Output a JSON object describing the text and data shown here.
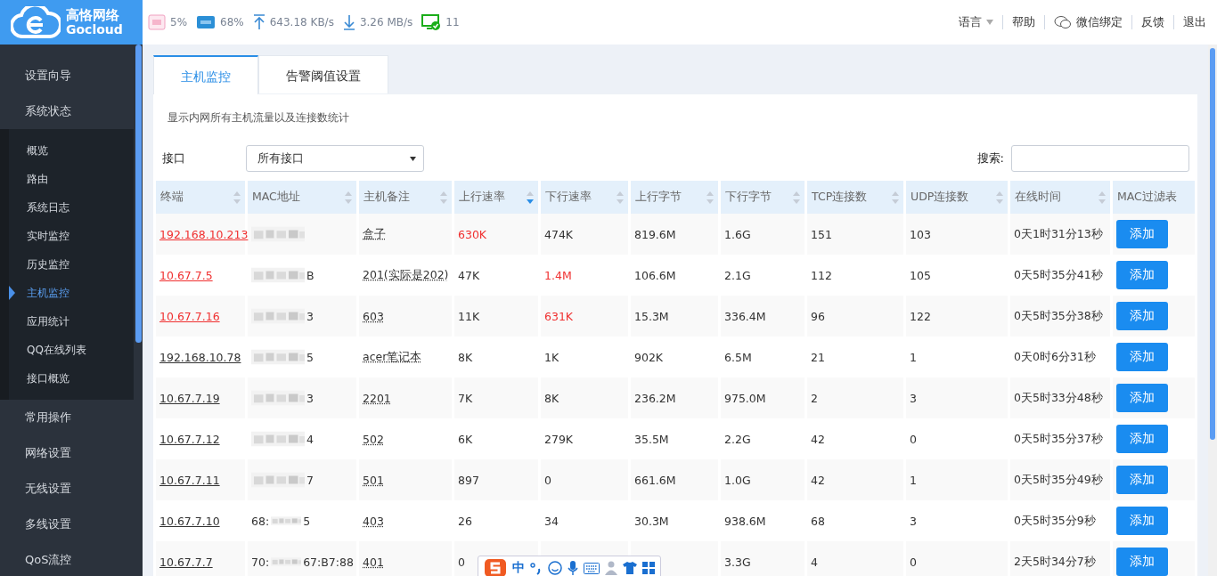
{
  "logo": {
    "name": "高恪网络",
    "brand": "Gocloud"
  },
  "status": [
    {
      "kind": "cpu",
      "value": "5%"
    },
    {
      "kind": "ram",
      "value": "68%"
    },
    {
      "kind": "up",
      "value": "643.18 KB/s"
    },
    {
      "kind": "down",
      "value": "3.26 MB/s"
    },
    {
      "kind": "online",
      "value": "11"
    }
  ],
  "top_links": [
    {
      "kind": "dropdown",
      "label": "语言"
    },
    {
      "kind": "plain",
      "label": "帮助"
    },
    {
      "kind": "wechat",
      "label": "微信绑定"
    },
    {
      "kind": "plain",
      "label": "反馈"
    },
    {
      "kind": "plain",
      "label": "退出"
    }
  ],
  "sidebar": {
    "items": [
      {
        "label": "设置向导"
      },
      {
        "label": "系统状态",
        "expanded": true,
        "children": [
          {
            "label": "概览",
            "selected": false
          },
          {
            "label": "路由",
            "selected": false
          },
          {
            "label": "系统日志",
            "selected": false
          },
          {
            "label": "实时监控",
            "selected": false
          },
          {
            "label": "历史监控",
            "selected": false
          },
          {
            "label": "主机监控",
            "selected": true
          },
          {
            "label": "应用统计",
            "selected": false
          },
          {
            "label": "QQ在线列表",
            "selected": false
          },
          {
            "label": "接口概览",
            "selected": false
          }
        ]
      },
      {
        "label": "常用操作"
      },
      {
        "label": "网络设置"
      },
      {
        "label": "无线设置"
      },
      {
        "label": "多线设置"
      },
      {
        "label": "QoS流控"
      }
    ]
  },
  "tabs": [
    {
      "label": "主机监控",
      "selected": true
    },
    {
      "label": "告警阈值设置",
      "selected": false
    }
  ],
  "description": "显示内网所有主机流量以及连接数统计",
  "interface": {
    "label": "接口",
    "value": "所有接口"
  },
  "search": {
    "label": "搜索:"
  },
  "table": {
    "columns": [
      {
        "label": "终端",
        "sortable": true,
        "sorted": false
      },
      {
        "label": "MAC地址",
        "sortable": true,
        "sorted": false
      },
      {
        "label": "主机备注",
        "sortable": true,
        "sorted": false
      },
      {
        "label": "上行速率",
        "sortable": true,
        "sorted": true
      },
      {
        "label": "下行速率",
        "sortable": true,
        "sorted": false
      },
      {
        "label": "上行字节",
        "sortable": true,
        "sorted": false
      },
      {
        "label": "下行字节",
        "sortable": true,
        "sorted": false
      },
      {
        "label": "TCP连接数",
        "sortable": true,
        "sorted": false
      },
      {
        "label": "UDP连接数",
        "sortable": true,
        "sorted": false
      },
      {
        "label": "在线时间",
        "sortable": true,
        "sorted": false
      },
      {
        "label": "MAC过滤表",
        "sortable": false
      }
    ],
    "rows": [
      {
        "ip": "192.168.10.213",
        "ip_alert": true,
        "note": "盒子",
        "up": "630K",
        "up_alert": true,
        "down": "474K",
        "down_alert": false,
        "up_bytes": "819.6M",
        "down_bytes": "1.6G",
        "tcp": "151",
        "udp": "103",
        "online": "0天1时31分13秒",
        "action": "添加"
      },
      {
        "ip": "10.67.7.5",
        "ip_alert": true,
        "mac_suffix": "B",
        "note": "201(实际是202)",
        "up": "47K",
        "up_alert": false,
        "down": "1.4M",
        "down_alert": true,
        "up_bytes": "106.6M",
        "down_bytes": "2.1G",
        "tcp": "112",
        "udp": "105",
        "online": "0天5时35分41秒",
        "action": "添加"
      },
      {
        "ip": "10.67.7.16",
        "ip_alert": true,
        "mac_suffix": "3",
        "note": "603",
        "up": "11K",
        "up_alert": false,
        "down": "631K",
        "down_alert": true,
        "up_bytes": "15.3M",
        "down_bytes": "336.4M",
        "tcp": "96",
        "udp": "122",
        "online": "0天5时35分38秒",
        "action": "添加"
      },
      {
        "ip": "192.168.10.78",
        "ip_alert": false,
        "mac_suffix": "5",
        "note": "acer笔记本",
        "up": "8K",
        "up_alert": false,
        "down": "1K",
        "down_alert": false,
        "up_bytes": "902K",
        "down_bytes": "6.5M",
        "tcp": "21",
        "udp": "1",
        "online": "0天0时6分31秒",
        "action": "添加"
      },
      {
        "ip": "10.67.7.19",
        "ip_alert": false,
        "mac_suffix": "3",
        "note": "2201",
        "up": "7K",
        "up_alert": false,
        "down": "8K",
        "down_alert": false,
        "up_bytes": "236.2M",
        "down_bytes": "975.0M",
        "tcp": "2",
        "udp": "3",
        "online": "0天5时33分48秒",
        "action": "添加"
      },
      {
        "ip": "10.67.7.12",
        "ip_alert": false,
        "mac_suffix": "4",
        "note": "502",
        "up": "6K",
        "up_alert": false,
        "down": "279K",
        "down_alert": false,
        "up_bytes": "35.5M",
        "down_bytes": "2.2G",
        "tcp": "42",
        "udp": "0",
        "online": "0天5时35分37秒",
        "action": "添加"
      },
      {
        "ip": "10.67.7.11",
        "ip_alert": false,
        "mac_suffix": "7",
        "note": "501",
        "up": "897",
        "up_alert": false,
        "down": "0",
        "down_alert": false,
        "up_bytes": "661.6M",
        "down_bytes": "1.0G",
        "tcp": "42",
        "udp": "1",
        "online": "0天5时35分49秒",
        "action": "添加"
      },
      {
        "ip": "10.67.7.10",
        "ip_alert": false,
        "mac_prefix": "68:",
        "mac_suffix": "5",
        "note": "403",
        "up": "26",
        "up_alert": false,
        "down": "34",
        "down_alert": false,
        "up_bytes": "30.3M",
        "down_bytes": "938.6M",
        "tcp": "68",
        "udp": "3",
        "online": "0天5时35分9秒",
        "action": "添加"
      },
      {
        "ip": "10.67.7.7",
        "ip_alert": false,
        "mac_prefix": "70:",
        "mac_suffix": "67:B7:88",
        "note": "401",
        "up": "0",
        "up_alert": false,
        "down_bytes": "3.3G",
        "tcp": "4",
        "udp": "0",
        "online": "2天5时34分7秒",
        "action": "添加"
      }
    ]
  },
  "ime_bar": {
    "mode": "中"
  }
}
